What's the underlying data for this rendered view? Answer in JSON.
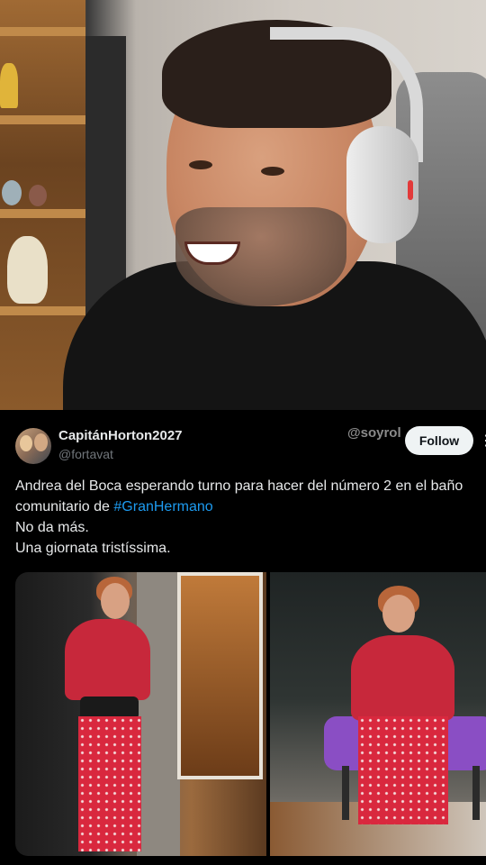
{
  "tweet": {
    "display_name": "CapitánHorton2027",
    "handle": "@fortavat",
    "watermark": "@soyrol",
    "follow_label": "Follow",
    "more_icon": "more-icon",
    "text_lines": [
      "Andrea del Boca esperando turno para hacer del número 2 en el baño",
      "comunitario de ",
      "No da más.",
      "Una giornata tristíssima."
    ],
    "hashtag": "#GranHermano",
    "media": {
      "count": 2
    }
  },
  "colors": {
    "background": "#000000",
    "text": "#e7e9ea",
    "secondary_text": "#71767b",
    "link": "#1d9bf0",
    "follow_bg": "#eff3f4"
  }
}
